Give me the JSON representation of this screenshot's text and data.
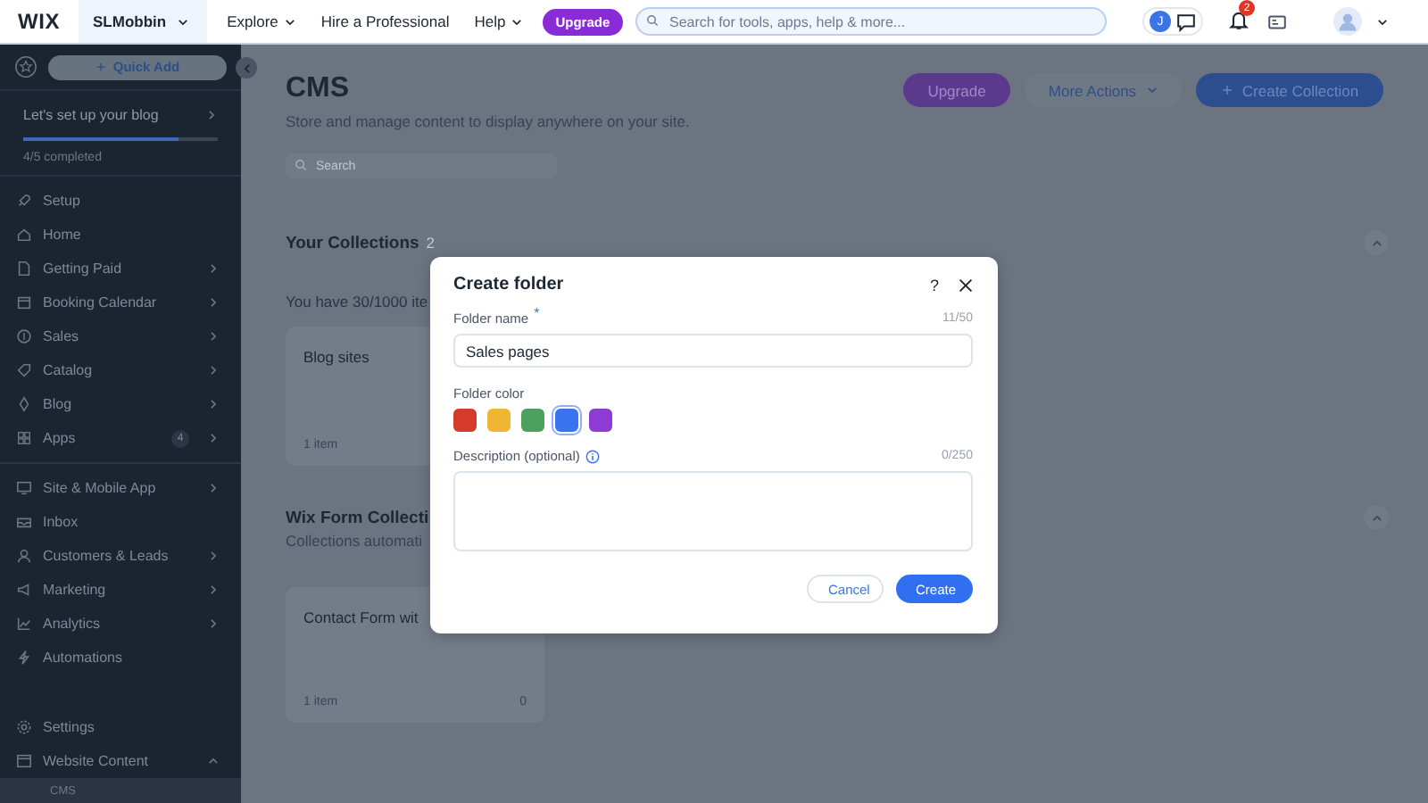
{
  "topbar": {
    "logo": "WIX",
    "site_menu": "SLMobbin",
    "nav": [
      {
        "label": "Explore",
        "dropdown": true
      },
      {
        "label": "Hire a Professional",
        "dropdown": false
      },
      {
        "label": "Help",
        "dropdown": true
      }
    ],
    "upgrade": "Upgrade",
    "search": {
      "placeholder": "Search for tools, apps, help & more..."
    },
    "account_initial": "J",
    "notification_count": "2"
  },
  "sidebar": {
    "quick_add": "Quick Add",
    "setup": {
      "title": "Let's set up your blog",
      "level": 0.8,
      "progress": "4/5 completed"
    },
    "groups": [
      {
        "items": [
          {
            "label": "Setup",
            "arrow": false,
            "selected": false
          },
          {
            "label": "Home",
            "arrow": false,
            "selected": false
          },
          {
            "label": "Getting Paid",
            "arrow": true,
            "expanded": false,
            "selected": false
          },
          {
            "label": "Booking Calendar",
            "arrow": true,
            "expanded": false,
            "selected": false
          },
          {
            "label": "Sales",
            "arrow": true,
            "expanded": false,
            "selected": false
          },
          {
            "label": "Catalog",
            "arrow": true,
            "expanded": false,
            "selected": false
          },
          {
            "label": "Blog",
            "arrow": true,
            "expanded": false,
            "selected": false
          },
          {
            "label": "Apps",
            "badge": "4",
            "arrow": true,
            "expanded": false,
            "selected": false
          }
        ]
      },
      {
        "items": [
          {
            "label": "Site & Mobile App",
            "arrow": true,
            "expanded": false,
            "selected": false
          },
          {
            "label": "Inbox",
            "arrow": false,
            "selected": false
          },
          {
            "label": "Customers & Leads",
            "arrow": true,
            "expanded": false,
            "selected": false
          },
          {
            "label": "Marketing",
            "arrow": true,
            "expanded": false,
            "selected": false
          },
          {
            "label": "Analytics",
            "arrow": true,
            "expanded": false,
            "selected": false
          },
          {
            "label": "Automations",
            "arrow": false,
            "selected": false
          }
        ]
      },
      {
        "items": [
          {
            "label": "Settings",
            "arrow": false,
            "selected": false
          },
          {
            "label": "Website Content",
            "arrow": true,
            "expanded": true,
            "selected": false,
            "children": [
              {
                "label": "CMS",
                "selected": true
              }
            ]
          }
        ]
      }
    ]
  },
  "main": {
    "title": "CMS",
    "subtitle": "Store and manage content to display anywhere on your site.",
    "search": {
      "placeholder": "Search"
    },
    "actions": [
      {
        "kind": "upgrade",
        "label": "Upgrade"
      },
      {
        "kind": "menu",
        "label": "More Actions"
      },
      {
        "kind": "create",
        "label": "Create Collection"
      }
    ],
    "sections": [
      {
        "title": "Your Collections",
        "count": "2",
        "expanded": true,
        "note": "You have 30/1000 ite",
        "cards": [
          {
            "title": "Blog sites",
            "meta": "1 item"
          }
        ]
      },
      {
        "title": "Wix Form Collecti",
        "subtitle": "Collections automati",
        "expanded": true,
        "cards": [
          {
            "title": "Contact Form wit",
            "meta": "1 item",
            "count": "0"
          }
        ]
      }
    ]
  },
  "dialog": {
    "title": "Create folder",
    "help": "?",
    "folder_name": {
      "label": "Folder name",
      "required_mark": "*",
      "counter": "11/50",
      "value": "Sales pages"
    },
    "folder_color": {
      "label": "Folder color",
      "colors": [
        {
          "color": "#d63a2a",
          "selected": false
        },
        {
          "color": "#f0b534",
          "selected": false
        },
        {
          "color": "#4ba25e",
          "selected": false
        },
        {
          "color": "#3a73f0",
          "selected": true
        },
        {
          "color": "#8e3ad4",
          "selected": false
        }
      ]
    },
    "description": {
      "label": "Description (optional)",
      "counter": "0/250"
    },
    "buttons": [
      {
        "kind": "secondary",
        "label": "Cancel"
      },
      {
        "kind": "primary",
        "label": "Create"
      }
    ]
  }
}
